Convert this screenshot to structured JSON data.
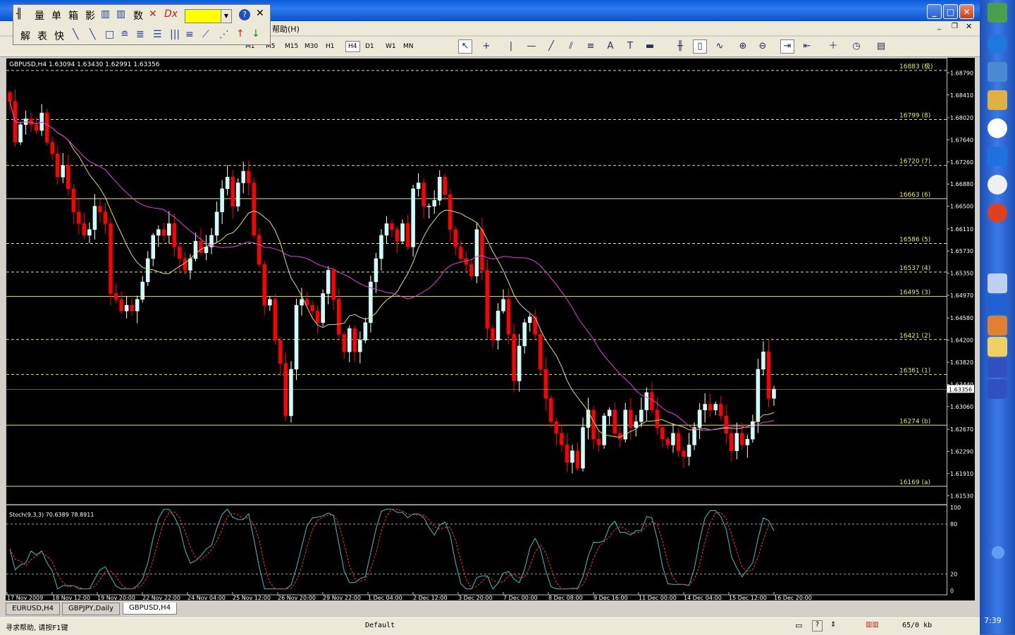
{
  "menu": {
    "help": "帮助",
    "help_key": "(H)"
  },
  "floating_toolbar": {
    "row1": [
      "量",
      "单",
      "箱",
      "影",
      "数"
    ],
    "row2": [
      "解",
      "表",
      "快"
    ]
  },
  "toolbar": {
    "timeframes": [
      "M1",
      "M5",
      "M15",
      "M30",
      "H1",
      "H4",
      "D1",
      "W1",
      "MN"
    ],
    "selected_timeframe": "H4",
    "cursor_mode": "arrow"
  },
  "chart": {
    "header": "GBPUSD,H4  1.63094 1.63430 1.62991 1.63356",
    "current_price": "1.63356",
    "price_ticks": [
      "1.68790",
      "1.68410",
      "1.68020",
      "1.67640",
      "1.67260",
      "1.66880",
      "1.66500",
      "1.66110",
      "1.65730",
      "1.65350",
      "1.64970",
      "1.64580",
      "1.64200",
      "1.63820",
      "1.63440",
      "1.63060",
      "1.62670",
      "1.62290",
      "1.61910",
      "1.61530"
    ],
    "time_ticks": [
      "17 Nov 2009",
      "18 Nov 12:00",
      "19 Nov 20:00",
      "22 Nov 22:00",
      "24 Nov 04:00",
      "25 Nov 12:00",
      "26 Nov 20:00",
      "29 Nov 22:00",
      "1 Dec 04:00",
      "2 Dec 12:00",
      "3 Dec 20:00",
      "7 Dec 00:00",
      "8 Dec 08:00",
      "9 Dec 16:00",
      "11 Dec 00:00",
      "14 Dec 04:00",
      "15 Dec 12:00",
      "16 Dec 20:00"
    ],
    "levels": [
      {
        "price": 1.6883,
        "label": "16883 (极)",
        "style": "dashed"
      },
      {
        "price": 1.6799,
        "label": "16799 (8)",
        "style": "dashed"
      },
      {
        "price": 1.672,
        "label": "16720 (7)",
        "style": "dashed"
      },
      {
        "price": 1.6663,
        "label": "16663 (6)",
        "style": "solid"
      },
      {
        "price": 1.6586,
        "label": "16586 (5)",
        "style": "dashed"
      },
      {
        "price": 1.6537,
        "label": "16537 (4)",
        "style": "dashed"
      },
      {
        "price": 1.6495,
        "label": "16495 (3)",
        "style": "solid"
      },
      {
        "price": 1.6421,
        "label": "16421 (2)",
        "style": "dashed"
      },
      {
        "price": 1.6361,
        "label": "16361 (1)",
        "style": "dashed"
      },
      {
        "price": 1.6274,
        "label": "16274 (b)",
        "style": "solid"
      },
      {
        "price": 1.6169,
        "label": "16169 (a)",
        "style": "solid"
      }
    ],
    "colors": {
      "up": "#ffffff",
      "down": "#ff0000",
      "up_body": "#c8ffff",
      "ma_fast": "#e0e060",
      "ma_slow": "#e040e0",
      "level": "#e8e860",
      "stoch_main": "#40c0c0",
      "stoch_signal": "#ff3030"
    },
    "closes": [
      1.683,
      1.676,
      1.679,
      1.68,
      1.679,
      1.678,
      1.681,
      1.676,
      1.674,
      1.67,
      1.672,
      1.668,
      1.664,
      1.662,
      1.66,
      1.661,
      1.665,
      1.664,
      1.662,
      1.65,
      1.649,
      1.647,
      1.648,
      1.647,
      1.649,
      1.652,
      1.656,
      1.66,
      1.661,
      1.66,
      1.662,
      1.658,
      1.656,
      1.654,
      1.656,
      1.659,
      1.657,
      1.658,
      1.66,
      1.664,
      1.668,
      1.67,
      1.665,
      1.669,
      1.671,
      1.669,
      1.66,
      1.655,
      1.648,
      1.649,
      1.642,
      1.638,
      1.629,
      1.637,
      1.648,
      1.649,
      1.648,
      1.647,
      1.645,
      1.65,
      1.654,
      1.649,
      1.643,
      1.64,
      1.644,
      1.64,
      1.642,
      1.645,
      1.652,
      1.656,
      1.66,
      1.662,
      1.661,
      1.659,
      1.662,
      1.658,
      1.668,
      1.669,
      1.665,
      1.665,
      1.666,
      1.67,
      1.667,
      1.661,
      1.658,
      1.656,
      1.655,
      1.653,
      1.661,
      1.654,
      1.644,
      1.642,
      1.647,
      1.649,
      1.643,
      1.635,
      1.641,
      1.645,
      1.646,
      1.643,
      1.637,
      1.632,
      1.628,
      1.626,
      1.624,
      1.621,
      1.623,
      1.62,
      1.627,
      1.63,
      1.625,
      1.624,
      1.629,
      1.63,
      1.626,
      1.625,
      1.63,
      1.627,
      1.628,
      1.63,
      1.633,
      1.63,
      1.627,
      1.625,
      1.624,
      1.626,
      1.623,
      1.622,
      1.624,
      1.627,
      1.63,
      1.631,
      1.63,
      1.631,
      1.629,
      1.626,
      1.623,
      1.626,
      1.624,
      1.625,
      1.628,
      1.637,
      1.64,
      1.632,
      1.6336
    ],
    "stoch_label": "Stoch(9,3,3) 70.6389 78.8911",
    "stoch_levels": [
      "100",
      "80",
      "20",
      "0"
    ]
  },
  "tabs": [
    "EURUSD,H4",
    "GBPJPY,Daily",
    "GBPUSD,H4"
  ],
  "active_tab": "GBPUSD,H4",
  "status": {
    "help": "寻求帮助, 请按F1键",
    "profile": "Default",
    "traffic": "65/0 kb"
  },
  "taskbar": {
    "time": "7:39"
  }
}
